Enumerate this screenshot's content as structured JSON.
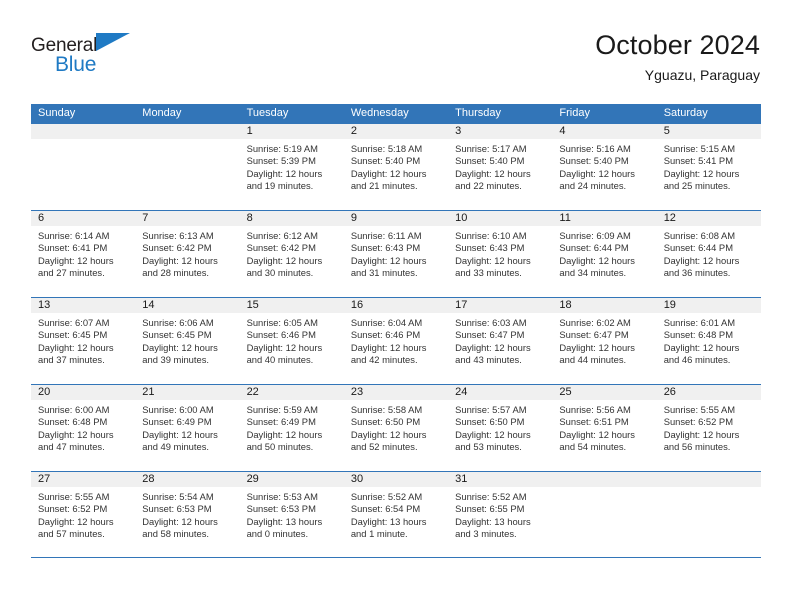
{
  "brand": {
    "name_part1": "General",
    "name_part2": "Blue",
    "flag_icon": "triangle-flag-icon",
    "accent_color": "#1f7ac4"
  },
  "header": {
    "title": "October 2024",
    "subtitle": "Yguazu, Paraguay"
  },
  "calendar": {
    "header_color": "#3275b8",
    "day_band_color": "#f0f0f0",
    "weekdays": [
      "Sunday",
      "Monday",
      "Tuesday",
      "Wednesday",
      "Thursday",
      "Friday",
      "Saturday"
    ],
    "weeks": [
      [
        {
          "empty": true
        },
        {
          "empty": true
        },
        {
          "day": "1",
          "sunrise": "Sunrise: 5:19 AM",
          "sunset": "Sunset: 5:39 PM",
          "daylight_1": "Daylight: 12 hours",
          "daylight_2": "and 19 minutes."
        },
        {
          "day": "2",
          "sunrise": "Sunrise: 5:18 AM",
          "sunset": "Sunset: 5:40 PM",
          "daylight_1": "Daylight: 12 hours",
          "daylight_2": "and 21 minutes."
        },
        {
          "day": "3",
          "sunrise": "Sunrise: 5:17 AM",
          "sunset": "Sunset: 5:40 PM",
          "daylight_1": "Daylight: 12 hours",
          "daylight_2": "and 22 minutes."
        },
        {
          "day": "4",
          "sunrise": "Sunrise: 5:16 AM",
          "sunset": "Sunset: 5:40 PM",
          "daylight_1": "Daylight: 12 hours",
          "daylight_2": "and 24 minutes."
        },
        {
          "day": "5",
          "sunrise": "Sunrise: 5:15 AM",
          "sunset": "Sunset: 5:41 PM",
          "daylight_1": "Daylight: 12 hours",
          "daylight_2": "and 25 minutes."
        }
      ],
      [
        {
          "day": "6",
          "sunrise": "Sunrise: 6:14 AM",
          "sunset": "Sunset: 6:41 PM",
          "daylight_1": "Daylight: 12 hours",
          "daylight_2": "and 27 minutes."
        },
        {
          "day": "7",
          "sunrise": "Sunrise: 6:13 AM",
          "sunset": "Sunset: 6:42 PM",
          "daylight_1": "Daylight: 12 hours",
          "daylight_2": "and 28 minutes."
        },
        {
          "day": "8",
          "sunrise": "Sunrise: 6:12 AM",
          "sunset": "Sunset: 6:42 PM",
          "daylight_1": "Daylight: 12 hours",
          "daylight_2": "and 30 minutes."
        },
        {
          "day": "9",
          "sunrise": "Sunrise: 6:11 AM",
          "sunset": "Sunset: 6:43 PM",
          "daylight_1": "Daylight: 12 hours",
          "daylight_2": "and 31 minutes."
        },
        {
          "day": "10",
          "sunrise": "Sunrise: 6:10 AM",
          "sunset": "Sunset: 6:43 PM",
          "daylight_1": "Daylight: 12 hours",
          "daylight_2": "and 33 minutes."
        },
        {
          "day": "11",
          "sunrise": "Sunrise: 6:09 AM",
          "sunset": "Sunset: 6:44 PM",
          "daylight_1": "Daylight: 12 hours",
          "daylight_2": "and 34 minutes."
        },
        {
          "day": "12",
          "sunrise": "Sunrise: 6:08 AM",
          "sunset": "Sunset: 6:44 PM",
          "daylight_1": "Daylight: 12 hours",
          "daylight_2": "and 36 minutes."
        }
      ],
      [
        {
          "day": "13",
          "sunrise": "Sunrise: 6:07 AM",
          "sunset": "Sunset: 6:45 PM",
          "daylight_1": "Daylight: 12 hours",
          "daylight_2": "and 37 minutes."
        },
        {
          "day": "14",
          "sunrise": "Sunrise: 6:06 AM",
          "sunset": "Sunset: 6:45 PM",
          "daylight_1": "Daylight: 12 hours",
          "daylight_2": "and 39 minutes."
        },
        {
          "day": "15",
          "sunrise": "Sunrise: 6:05 AM",
          "sunset": "Sunset: 6:46 PM",
          "daylight_1": "Daylight: 12 hours",
          "daylight_2": "and 40 minutes."
        },
        {
          "day": "16",
          "sunrise": "Sunrise: 6:04 AM",
          "sunset": "Sunset: 6:46 PM",
          "daylight_1": "Daylight: 12 hours",
          "daylight_2": "and 42 minutes."
        },
        {
          "day": "17",
          "sunrise": "Sunrise: 6:03 AM",
          "sunset": "Sunset: 6:47 PM",
          "daylight_1": "Daylight: 12 hours",
          "daylight_2": "and 43 minutes."
        },
        {
          "day": "18",
          "sunrise": "Sunrise: 6:02 AM",
          "sunset": "Sunset: 6:47 PM",
          "daylight_1": "Daylight: 12 hours",
          "daylight_2": "and 44 minutes."
        },
        {
          "day": "19",
          "sunrise": "Sunrise: 6:01 AM",
          "sunset": "Sunset: 6:48 PM",
          "daylight_1": "Daylight: 12 hours",
          "daylight_2": "and 46 minutes."
        }
      ],
      [
        {
          "day": "20",
          "sunrise": "Sunrise: 6:00 AM",
          "sunset": "Sunset: 6:48 PM",
          "daylight_1": "Daylight: 12 hours",
          "daylight_2": "and 47 minutes."
        },
        {
          "day": "21",
          "sunrise": "Sunrise: 6:00 AM",
          "sunset": "Sunset: 6:49 PM",
          "daylight_1": "Daylight: 12 hours",
          "daylight_2": "and 49 minutes."
        },
        {
          "day": "22",
          "sunrise": "Sunrise: 5:59 AM",
          "sunset": "Sunset: 6:49 PM",
          "daylight_1": "Daylight: 12 hours",
          "daylight_2": "and 50 minutes."
        },
        {
          "day": "23",
          "sunrise": "Sunrise: 5:58 AM",
          "sunset": "Sunset: 6:50 PM",
          "daylight_1": "Daylight: 12 hours",
          "daylight_2": "and 52 minutes."
        },
        {
          "day": "24",
          "sunrise": "Sunrise: 5:57 AM",
          "sunset": "Sunset: 6:50 PM",
          "daylight_1": "Daylight: 12 hours",
          "daylight_2": "and 53 minutes."
        },
        {
          "day": "25",
          "sunrise": "Sunrise: 5:56 AM",
          "sunset": "Sunset: 6:51 PM",
          "daylight_1": "Daylight: 12 hours",
          "daylight_2": "and 54 minutes."
        },
        {
          "day": "26",
          "sunrise": "Sunrise: 5:55 AM",
          "sunset": "Sunset: 6:52 PM",
          "daylight_1": "Daylight: 12 hours",
          "daylight_2": "and 56 minutes."
        }
      ],
      [
        {
          "day": "27",
          "sunrise": "Sunrise: 5:55 AM",
          "sunset": "Sunset: 6:52 PM",
          "daylight_1": "Daylight: 12 hours",
          "daylight_2": "and 57 minutes."
        },
        {
          "day": "28",
          "sunrise": "Sunrise: 5:54 AM",
          "sunset": "Sunset: 6:53 PM",
          "daylight_1": "Daylight: 12 hours",
          "daylight_2": "and 58 minutes."
        },
        {
          "day": "29",
          "sunrise": "Sunrise: 5:53 AM",
          "sunset": "Sunset: 6:53 PM",
          "daylight_1": "Daylight: 13 hours",
          "daylight_2": "and 0 minutes."
        },
        {
          "day": "30",
          "sunrise": "Sunrise: 5:52 AM",
          "sunset": "Sunset: 6:54 PM",
          "daylight_1": "Daylight: 13 hours",
          "daylight_2": "and 1 minute."
        },
        {
          "day": "31",
          "sunrise": "Sunrise: 5:52 AM",
          "sunset": "Sunset: 6:55 PM",
          "daylight_1": "Daylight: 13 hours",
          "daylight_2": "and 3 minutes."
        },
        {
          "empty": true
        },
        {
          "empty": true
        }
      ]
    ]
  }
}
